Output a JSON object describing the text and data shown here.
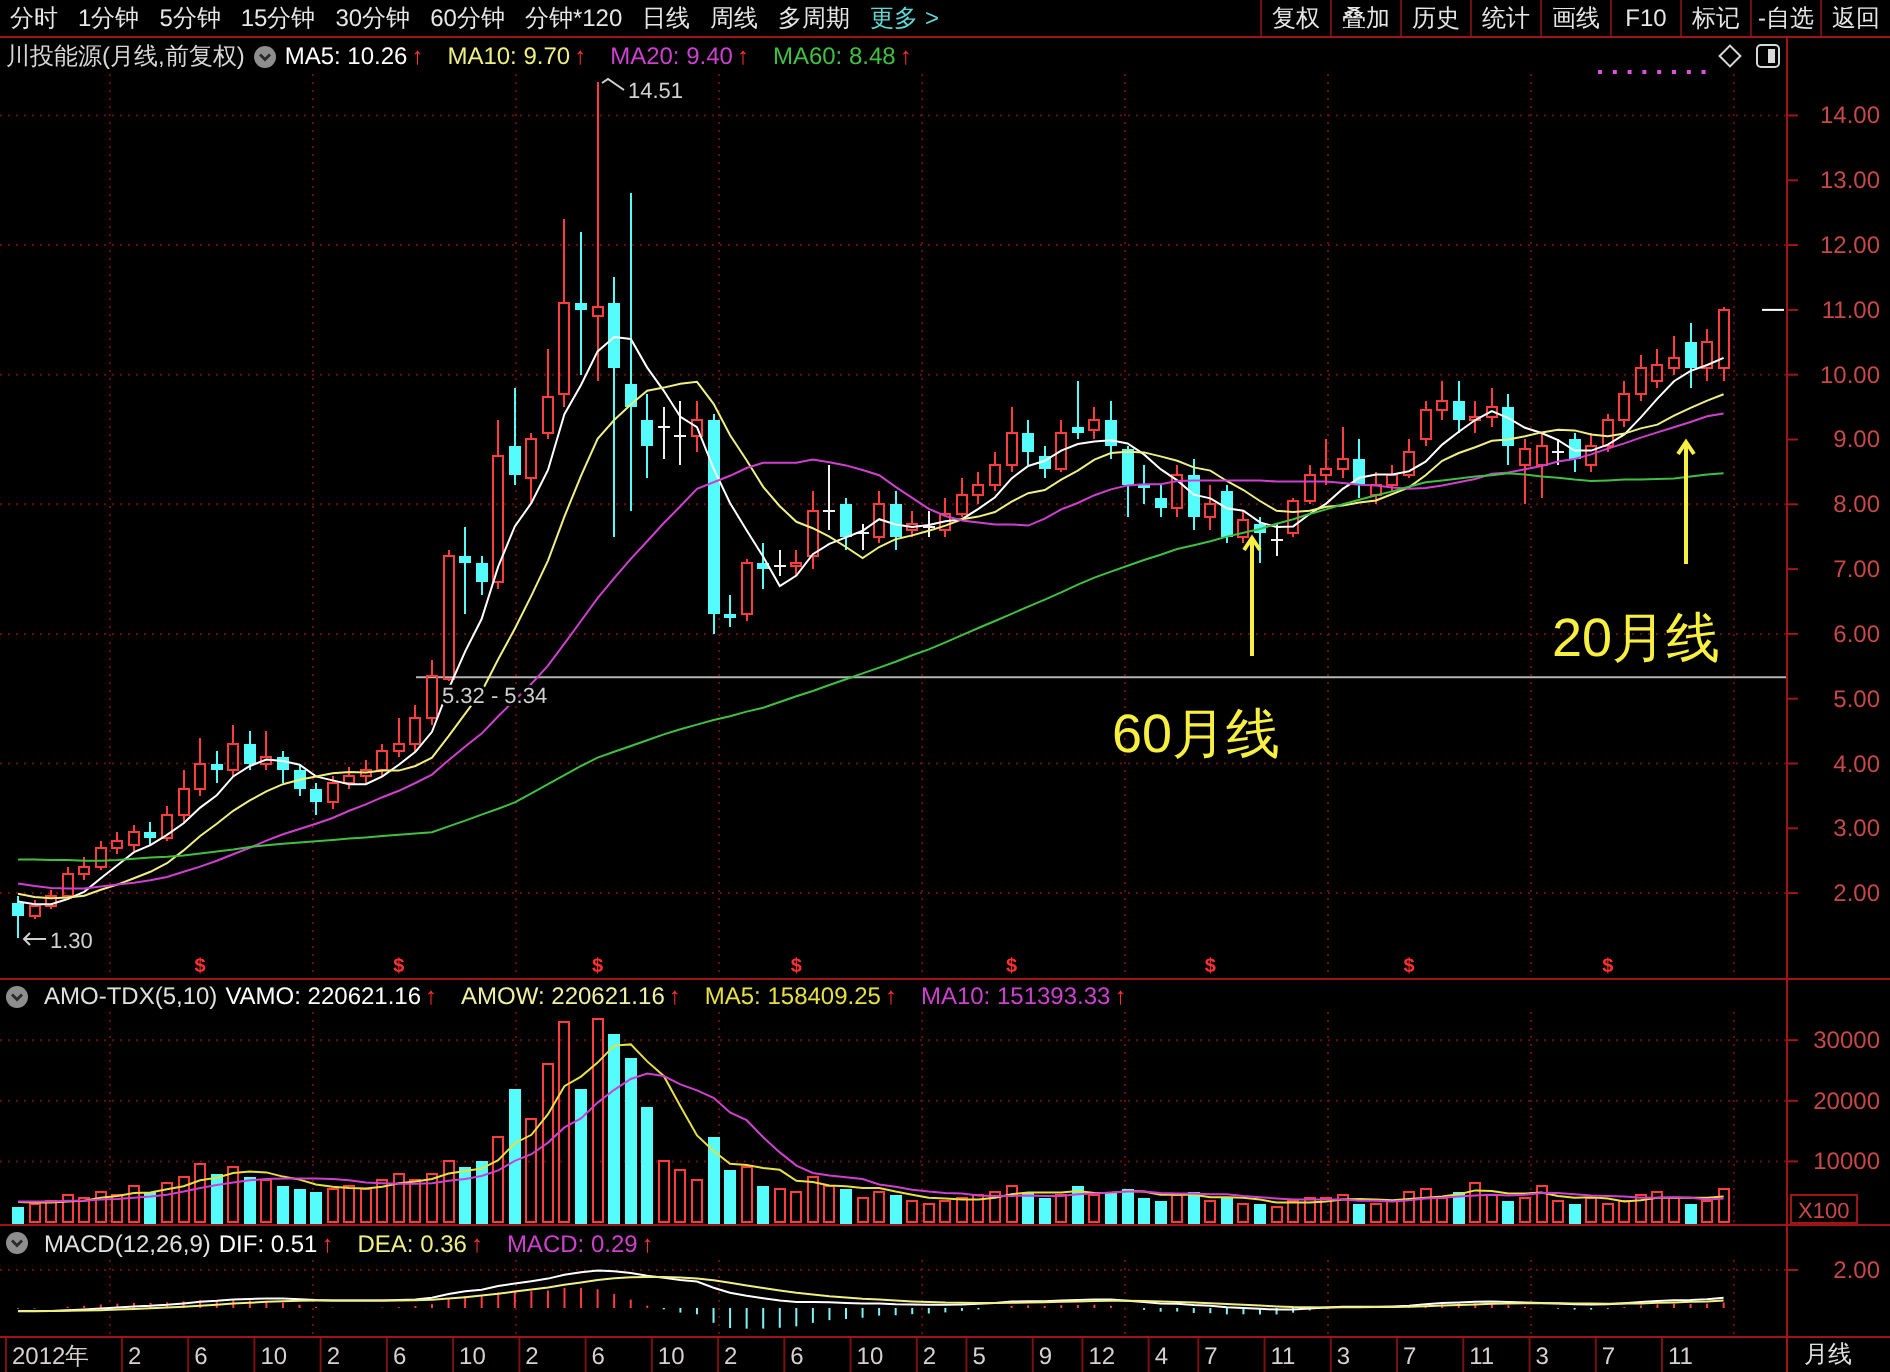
{
  "menu": {
    "periods": [
      {
        "label": "分时",
        "selected": false
      },
      {
        "label": "1分钟",
        "selected": false
      },
      {
        "label": "5分钟",
        "selected": false
      },
      {
        "label": "15分钟",
        "selected": false
      },
      {
        "label": "30分钟",
        "selected": false
      },
      {
        "label": "60分钟",
        "selected": false
      },
      {
        "label": "分钟*120",
        "selected": false
      },
      {
        "label": "日线",
        "selected": false
      },
      {
        "label": "周线",
        "selected": false
      },
      {
        "label": "多周期",
        "selected": false
      },
      {
        "label": "更多 >",
        "selected": true
      }
    ],
    "tools": [
      "复权",
      "叠加",
      "历史",
      "统计",
      "画线",
      "F10",
      "标记",
      "-自选",
      "返回"
    ]
  },
  "price_panel": {
    "title": "川投能源(月线,前复权)",
    "indicators": [
      {
        "text": "MA5: 10.26",
        "trend": "↑",
        "color": "#ffffff"
      },
      {
        "text": "MA10: 9.70",
        "trend": "↑",
        "color": "#f0f080"
      },
      {
        "text": "MA20: 9.40",
        "trend": "↑",
        "color": "#d040d0"
      },
      {
        "text": "MA60: 8.48",
        "trend": "↑",
        "color": "#40c040"
      }
    ],
    "chart_data": {
      "type": "candlestick",
      "grid": true,
      "ylim": [
        0.69,
        14.64
      ],
      "yticks": [
        {
          "value": 14,
          "label": "14.00"
        },
        {
          "value": 13,
          "label": "13.00"
        },
        {
          "value": 12,
          "label": "12.00"
        },
        {
          "value": 11,
          "label": "11.00"
        },
        {
          "value": 10,
          "label": "10.00"
        },
        {
          "value": 9,
          "label": "9.00"
        },
        {
          "value": 8,
          "label": "8.00"
        },
        {
          "value": 7,
          "label": "7.00"
        },
        {
          "value": 6,
          "label": "6.00"
        },
        {
          "value": 5,
          "label": "5.00"
        },
        {
          "value": 4,
          "label": "4.00"
        },
        {
          "value": 3,
          "label": "3.00"
        },
        {
          "value": 2,
          "label": "2.00"
        }
      ],
      "ohlc": [
        [
          1.85,
          1.95,
          1.3,
          1.65
        ],
        [
          1.65,
          1.9,
          1.6,
          1.8
        ],
        [
          1.8,
          2.05,
          1.75,
          1.95
        ],
        [
          1.95,
          2.4,
          1.9,
          2.3
        ],
        [
          2.3,
          2.55,
          2.2,
          2.4
        ],
        [
          2.4,
          2.8,
          2.35,
          2.7
        ],
        [
          2.7,
          2.95,
          2.6,
          2.8
        ],
        [
          2.75,
          3.05,
          2.65,
          2.95
        ],
        [
          2.95,
          3.1,
          2.75,
          2.85
        ],
        [
          2.85,
          3.35,
          2.8,
          3.2
        ],
        [
          3.2,
          3.9,
          3.1,
          3.6
        ],
        [
          3.6,
          4.4,
          3.5,
          4.0
        ],
        [
          4.0,
          4.2,
          3.7,
          3.9
        ],
        [
          3.9,
          4.6,
          3.8,
          4.3
        ],
        [
          4.3,
          4.5,
          3.9,
          4.0
        ],
        [
          4.0,
          4.5,
          3.9,
          4.1
        ],
        [
          4.1,
          4.2,
          3.7,
          3.9
        ],
        [
          3.9,
          4.0,
          3.5,
          3.6
        ],
        [
          3.6,
          3.7,
          3.2,
          3.4
        ],
        [
          3.4,
          3.8,
          3.3,
          3.7
        ],
        [
          3.7,
          3.95,
          3.6,
          3.8
        ],
        [
          3.8,
          4.05,
          3.7,
          3.9
        ],
        [
          3.9,
          4.3,
          3.8,
          4.2
        ],
        [
          4.2,
          4.7,
          4.1,
          4.3
        ],
        [
          4.3,
          4.9,
          4.2,
          4.7
        ],
        [
          4.7,
          5.6,
          4.6,
          5.35
        ],
        [
          5.3,
          7.3,
          5.28,
          7.2
        ],
        [
          7.2,
          7.65,
          6.3,
          7.1
        ],
        [
          7.1,
          7.2,
          6.6,
          6.8
        ],
        [
          6.8,
          9.3,
          6.7,
          8.75
        ],
        [
          8.9,
          9.8,
          8.3,
          8.45
        ],
        [
          8.4,
          9.1,
          8.0,
          9.0
        ],
        [
          9.1,
          10.4,
          9.0,
          9.65
        ],
        [
          9.7,
          12.4,
          9.5,
          11.1
        ],
        [
          11.1,
          12.2,
          10.0,
          11.0
        ],
        [
          10.9,
          14.51,
          9.9,
          11.05
        ],
        [
          11.1,
          11.5,
          7.5,
          10.1
        ],
        [
          9.85,
          12.8,
          7.9,
          9.5
        ],
        [
          9.3,
          9.7,
          8.4,
          8.9
        ],
        [
          9.2,
          9.5,
          8.7,
          9.2
        ],
        [
          9.05,
          9.6,
          8.6,
          9.05
        ],
        [
          9.05,
          9.6,
          8.8,
          9.3
        ],
        [
          9.3,
          9.4,
          6.0,
          6.3
        ],
        [
          6.3,
          6.6,
          6.1,
          6.25
        ],
        [
          6.3,
          7.15,
          6.2,
          7.1
        ],
        [
          7.1,
          7.4,
          6.7,
          7.0
        ],
        [
          7.05,
          7.3,
          6.9,
          7.05
        ],
        [
          7.05,
          7.3,
          6.9,
          7.1
        ],
        [
          7.2,
          8.2,
          7.0,
          7.9
        ],
        [
          7.9,
          8.6,
          7.6,
          7.9
        ],
        [
          8.0,
          8.1,
          7.3,
          7.5
        ],
        [
          7.55,
          7.7,
          7.3,
          7.55
        ],
        [
          7.5,
          8.2,
          7.4,
          8.0
        ],
        [
          8.0,
          8.2,
          7.3,
          7.5
        ],
        [
          7.6,
          7.9,
          7.5,
          7.7
        ],
        [
          7.65,
          7.9,
          7.5,
          7.65
        ],
        [
          7.6,
          8.1,
          7.5,
          7.85
        ],
        [
          7.85,
          8.4,
          7.8,
          8.15
        ],
        [
          8.15,
          8.5,
          8.0,
          8.3
        ],
        [
          8.3,
          8.8,
          8.2,
          8.6
        ],
        [
          8.6,
          9.5,
          8.5,
          9.1
        ],
        [
          9.1,
          9.3,
          8.6,
          8.8
        ],
        [
          8.75,
          8.9,
          8.4,
          8.55
        ],
        [
          8.55,
          9.3,
          8.5,
          9.1
        ],
        [
          9.2,
          9.9,
          9.0,
          9.1
        ],
        [
          9.15,
          9.5,
          9.0,
          9.3
        ],
        [
          9.3,
          9.6,
          8.7,
          8.9
        ],
        [
          8.85,
          8.9,
          7.8,
          8.3
        ],
        [
          8.3,
          8.6,
          8.0,
          8.25
        ],
        [
          8.1,
          8.3,
          7.8,
          7.95
        ],
        [
          7.95,
          8.6,
          7.8,
          8.45
        ],
        [
          8.45,
          8.7,
          7.6,
          7.8
        ],
        [
          7.8,
          8.3,
          7.6,
          8.0
        ],
        [
          8.2,
          8.3,
          7.4,
          7.5
        ],
        [
          7.5,
          7.9,
          7.4,
          7.75
        ],
        [
          7.7,
          7.8,
          7.1,
          7.55
        ],
        [
          7.45,
          7.7,
          7.2,
          7.45
        ],
        [
          7.55,
          8.1,
          7.5,
          8.05
        ],
        [
          8.05,
          8.6,
          8.0,
          8.45
        ],
        [
          8.45,
          9.0,
          8.3,
          8.55
        ],
        [
          8.55,
          9.2,
          8.4,
          8.7
        ],
        [
          8.7,
          9.0,
          8.1,
          8.3
        ],
        [
          8.15,
          8.5,
          8.0,
          8.3
        ],
        [
          8.3,
          8.6,
          8.2,
          8.45
        ],
        [
          8.45,
          9.0,
          8.4,
          8.8
        ],
        [
          9.0,
          9.6,
          8.9,
          9.45
        ],
        [
          9.45,
          9.9,
          9.3,
          9.6
        ],
        [
          9.6,
          9.9,
          9.1,
          9.3
        ],
        [
          9.3,
          9.6,
          9.1,
          9.35
        ],
        [
          9.35,
          9.8,
          9.2,
          9.5
        ],
        [
          9.5,
          9.7,
          8.6,
          8.9
        ],
        [
          8.6,
          9.0,
          8.0,
          8.85
        ],
        [
          8.6,
          9.1,
          8.1,
          8.9
        ],
        [
          8.8,
          9.0,
          8.6,
          8.8
        ],
        [
          9.0,
          9.1,
          8.5,
          8.7
        ],
        [
          8.6,
          9.1,
          8.5,
          8.9
        ],
        [
          8.9,
          9.4,
          8.8,
          9.3
        ],
        [
          9.3,
          9.9,
          9.2,
          9.7
        ],
        [
          9.7,
          10.3,
          9.6,
          10.1
        ],
        [
          9.9,
          10.4,
          9.8,
          10.15
        ],
        [
          10.1,
          10.6,
          10.0,
          10.25
        ],
        [
          10.5,
          10.8,
          9.8,
          10.1
        ],
        [
          10.1,
          10.7,
          9.9,
          10.5
        ],
        [
          10.1,
          11.05,
          9.9,
          11.0
        ]
      ],
      "series": [
        {
          "type": "line",
          "color": "#ffffff",
          "values": [
            1.87,
            1.83,
            1.83,
            1.91,
            2.02,
            2.23,
            2.43,
            2.63,
            2.74,
            2.9,
            3.08,
            3.32,
            3.51,
            3.8,
            3.96,
            4.06,
            4.04,
            3.98,
            3.8,
            3.74,
            3.68,
            3.68,
            3.8,
            3.98,
            4.18,
            4.49,
            5.15,
            5.73,
            6.23,
            7.04,
            7.66,
            8.02,
            8.53,
            9.39,
            9.84,
            10.36,
            10.58,
            10.55,
            10.11,
            9.75,
            9.35,
            9.19,
            8.55,
            8.02,
            7.6,
            7.19,
            6.74,
            6.9,
            7.23,
            7.39,
            7.49,
            7.59,
            7.77,
            7.69,
            7.65,
            7.68,
            7.74,
            7.77,
            7.93,
            8.11,
            8.4,
            8.59,
            8.67,
            8.83,
            8.93,
            8.97,
            8.99,
            8.94,
            8.77,
            8.54,
            8.37,
            8.15,
            8.09,
            7.94,
            7.9,
            7.72,
            7.65,
            7.66,
            7.85,
            8.01,
            8.24,
            8.41,
            8.46,
            8.46,
            8.51,
            8.66,
            8.92,
            9.12,
            9.3,
            9.44,
            9.33,
            9.18,
            9.1,
            8.99,
            8.83,
            8.83,
            8.92,
            9.08,
            9.34,
            9.63,
            9.9,
            10.06,
            10.15,
            10.26
          ]
        },
        {
          "type": "line",
          "color": "#f0f080",
          "values": [
            1.99,
            1.94,
            1.92,
            1.93,
            1.96,
            2.05,
            2.13,
            2.23,
            2.33,
            2.46,
            2.66,
            2.88,
            3.07,
            3.27,
            3.43,
            3.57,
            3.68,
            3.75,
            3.8,
            3.85,
            3.87,
            3.86,
            3.89,
            3.89,
            3.96,
            4.09,
            4.42,
            4.77,
            5.11,
            5.61,
            6.08,
            6.59,
            7.13,
            7.81,
            8.44,
            9.01,
            9.3,
            9.54,
            9.75,
            9.8,
            9.86,
            9.89,
            9.55,
            9.07,
            8.68,
            8.27,
            7.97,
            7.73,
            7.63,
            7.5,
            7.34,
            7.17,
            7.34,
            7.46,
            7.52,
            7.59,
            7.67,
            7.77,
            7.81,
            7.88,
            8.04,
            8.17,
            8.22,
            8.38,
            8.52,
            8.69,
            8.79,
            8.81,
            8.8,
            8.74,
            8.67,
            8.57,
            8.52,
            8.36,
            8.22,
            8.05,
            7.9,
            7.88,
            7.9,
            7.96,
            7.98,
            8.03,
            8.06,
            8.16,
            8.26,
            8.45,
            8.67,
            8.79,
            8.88,
            8.98,
            9.0,
            9.05,
            9.11,
            9.15,
            9.14,
            9.08,
            9.05,
            9.09,
            9.17,
            9.23,
            9.37,
            9.49,
            9.6,
            9.7
          ]
        },
        {
          "type": "line",
          "color": "#d040d0",
          "values": [
            2.15,
            2.11,
            2.08,
            2.07,
            2.07,
            2.1,
            2.13,
            2.16,
            2.2,
            2.25,
            2.33,
            2.41,
            2.5,
            2.6,
            2.7,
            2.81,
            2.91,
            2.99,
            3.07,
            3.16,
            3.27,
            3.37,
            3.48,
            3.58,
            3.7,
            3.83,
            4.05,
            4.26,
            4.46,
            4.73,
            4.98,
            5.23,
            5.51,
            5.85,
            6.2,
            6.55,
            6.86,
            7.16,
            7.43,
            7.71,
            7.97,
            8.24,
            8.34,
            8.44,
            8.56,
            8.64,
            8.64,
            8.64,
            8.69,
            8.65,
            8.6,
            8.53,
            8.45,
            8.27,
            8.1,
            7.93,
            7.82,
            7.75,
            7.72,
            7.69,
            7.69,
            7.67,
            7.78,
            7.92,
            8.02,
            8.14,
            8.23,
            8.29,
            8.31,
            8.31,
            8.36,
            8.37,
            8.37,
            8.37,
            8.37,
            8.37,
            8.35,
            8.35,
            8.35,
            8.35,
            8.33,
            8.3,
            8.29,
            8.26,
            8.24,
            8.25,
            8.29,
            8.34,
            8.39,
            8.47,
            8.49,
            8.54,
            8.59,
            8.66,
            8.7,
            8.77,
            8.86,
            8.94,
            9.03,
            9.11,
            9.19,
            9.27,
            9.36,
            9.4
          ]
        },
        {
          "type": "line",
          "color": "#40c040",
          "values": [
            2.52,
            2.52,
            2.51,
            2.51,
            2.5,
            2.5,
            2.51,
            2.53,
            2.55,
            2.56,
            2.58,
            2.61,
            2.64,
            2.67,
            2.71,
            2.74,
            2.76,
            2.78,
            2.8,
            2.82,
            2.84,
            2.86,
            2.88,
            2.9,
            2.92,
            2.94,
            3.03,
            3.12,
            3.21,
            3.3,
            3.4,
            3.54,
            3.68,
            3.82,
            3.96,
            4.09,
            4.18,
            4.27,
            4.36,
            4.45,
            4.53,
            4.6,
            4.67,
            4.73,
            4.8,
            4.86,
            4.95,
            5.04,
            5.12,
            5.21,
            5.3,
            5.39,
            5.48,
            5.57,
            5.67,
            5.76,
            5.87,
            5.98,
            6.09,
            6.2,
            6.31,
            6.42,
            6.53,
            6.64,
            6.76,
            6.87,
            6.96,
            7.05,
            7.14,
            7.22,
            7.31,
            7.37,
            7.43,
            7.5,
            7.56,
            7.62,
            7.7,
            7.77,
            7.85,
            7.92,
            8.0,
            8.07,
            8.14,
            8.2,
            8.27,
            8.34,
            8.37,
            8.4,
            8.43,
            8.45,
            8.48,
            8.46,
            8.43,
            8.41,
            8.38,
            8.36,
            8.37,
            8.38,
            8.38,
            8.39,
            8.4,
            8.43,
            8.46,
            8.48
          ]
        }
      ]
    },
    "high_label": "14.51",
    "low_label": "1.30",
    "line_label": "5.32 - 5.34",
    "annotations": [
      "60月线",
      "20月线"
    ],
    "dividend_marks": [
      "$",
      "$",
      "$",
      "$",
      "$",
      "$",
      "$",
      "$"
    ]
  },
  "volume_panel": {
    "name": "AMO-TDX(5,10)",
    "indicators": [
      {
        "text": "VAMO: 220621.16",
        "trend": "↑",
        "color": "#ffffff"
      },
      {
        "text": "AMOW: 220621.16",
        "trend": "↑",
        "color": "#f0f0a0"
      },
      {
        "text": "MA5: 158409.25",
        "trend": "↑",
        "color": "#e8e040"
      },
      {
        "text": "MA10: 151393.33",
        "trend": "↑",
        "color": "#d040d0"
      }
    ],
    "chart_data": {
      "type": "bar",
      "grid": true,
      "ylim": [
        0,
        34650
      ],
      "yticks": [
        30000,
        20000,
        10000
      ],
      "series": [
        {
          "type": "bar",
          "values": [
            2500,
            3000,
            3500,
            4500,
            4000,
            5000,
            4500,
            6000,
            5000,
            6500,
            7500,
            9500,
            8000,
            9000,
            7500,
            7000,
            6000,
            5500,
            5000,
            5500,
            6000,
            5500,
            7000,
            8000,
            7000,
            8000,
            10000,
            9000,
            10000,
            14000,
            22000,
            17000,
            26000,
            33000,
            22000,
            33500,
            31000,
            27000,
            19000,
            10000,
            8500,
            7000,
            14000,
            8500,
            9000,
            6000,
            5500,
            5000,
            7500,
            6000,
            5500,
            4000,
            5000,
            4500,
            3500,
            3000,
            3500,
            4000,
            4500,
            5000,
            6000,
            5000,
            4000,
            4500,
            6000,
            4500,
            5000,
            5500,
            4000,
            3500,
            4500,
            5000,
            3500,
            4000,
            3000,
            3000,
            2500,
            3500,
            4000,
            4000,
            4500,
            3000,
            3000,
            3500,
            5000,
            5500,
            4000,
            5000,
            6500,
            4500,
            3500,
            4000,
            6000,
            3500,
            3000,
            4000,
            3000,
            3500,
            4500,
            5000,
            4000,
            3000,
            3500,
            5500
          ],
          "colors": [
            "#54fcfc",
            "#ff3c3c",
            "#ff3c3c",
            "#ff3c3c",
            "#ff3c3c",
            "#ff3c3c",
            "#ff3c3c",
            "#ff3c3c",
            "#54fcfc",
            "#ff3c3c",
            "#ff3c3c",
            "#ff3c3c",
            "#54fcfc",
            "#ff3c3c",
            "#54fcfc",
            "#ff3c3c",
            "#54fcfc",
            "#54fcfc",
            "#54fcfc",
            "#ff3c3c",
            "#ff3c3c",
            "#ff3c3c",
            "#ff3c3c",
            "#ff3c3c",
            "#ff3c3c",
            "#ff3c3c",
            "#ff3c3c",
            "#54fcfc",
            "#54fcfc",
            "#ff3c3c",
            "#54fcfc",
            "#ff3c3c",
            "#ff3c3c",
            "#ff3c3c",
            "#54fcfc",
            "#ff3c3c",
            "#54fcfc",
            "#54fcfc",
            "#54fcfc",
            "#ff3c3c",
            "#ff3c3c",
            "#ff3c3c",
            "#54fcfc",
            "#54fcfc",
            "#ff3c3c",
            "#54fcfc",
            "#ff3c3c",
            "#ff3c3c",
            "#ff3c3c",
            "#ff3c3c",
            "#54fcfc",
            "#ff3c3c",
            "#ff3c3c",
            "#54fcfc",
            "#ff3c3c",
            "#ff3c3c",
            "#ff3c3c",
            "#ff3c3c",
            "#ff3c3c",
            "#ff3c3c",
            "#ff3c3c",
            "#54fcfc",
            "#54fcfc",
            "#ff3c3c",
            "#54fcfc",
            "#ff3c3c",
            "#54fcfc",
            "#54fcfc",
            "#54fcfc",
            "#54fcfc",
            "#ff3c3c",
            "#54fcfc",
            "#ff3c3c",
            "#54fcfc",
            "#ff3c3c",
            "#54fcfc",
            "#ff3c3c",
            "#ff3c3c",
            "#ff3c3c",
            "#ff3c3c",
            "#ff3c3c",
            "#54fcfc",
            "#ff3c3c",
            "#ff3c3c",
            "#ff3c3c",
            "#ff3c3c",
            "#ff3c3c",
            "#54fcfc",
            "#ff3c3c",
            "#ff3c3c",
            "#54fcfc",
            "#ff3c3c",
            "#ff3c3c",
            "#ff3c3c",
            "#54fcfc",
            "#ff3c3c",
            "#ff3c3c",
            "#ff3c3c",
            "#ff3c3c",
            "#ff3c3c",
            "#ff3c3c",
            "#54fcfc",
            "#ff3c3c",
            "#ff3c3c"
          ]
        },
        {
          "type": "line",
          "color": "#e8e040",
          "values": [
            3300,
            3200,
            3200,
            3400,
            3500,
            4000,
            4300,
            4800,
            4900,
            5400,
            5900,
            6900,
            7300,
            8100,
            8300,
            8200,
            7500,
            7000,
            6200,
            5800,
            5600,
            5500,
            5800,
            6400,
            6700,
            7100,
            8000,
            8400,
            8800,
            10200,
            13000,
            14400,
            17800,
            22400,
            24000,
            26300,
            29100,
            29300,
            26500,
            24100,
            19100,
            14300,
            11700,
            9600,
            9400,
            8900,
            8600,
            6800,
            6600,
            6000,
            5900,
            5600,
            5600,
            5000,
            4500,
            4000,
            3900,
            3700,
            3700,
            4000,
            4600,
            4900,
            4900,
            4900,
            5100,
            4800,
            4800,
            5100,
            5000,
            4500,
            4500,
            4500,
            4100,
            4100,
            4000,
            3700,
            3200,
            3200,
            3200,
            3400,
            3700,
            3800,
            3700,
            3600,
            3800,
            4000,
            4200,
            4600,
            5200,
            5100,
            4700,
            4700,
            4900,
            4300,
            4000,
            4100,
            3900,
            3400,
            3600,
            4000,
            4000,
            4000,
            4000,
            4200
          ]
        },
        {
          "type": "line",
          "color": "#d040d0",
          "values": [
            3400,
            3400,
            3400,
            3500,
            3500,
            3700,
            3800,
            4000,
            4200,
            4500,
            5000,
            5600,
            6100,
            6500,
            6900,
            7100,
            7200,
            7200,
            7200,
            7100,
            6900,
            6500,
            6400,
            6300,
            6300,
            6400,
            6800,
            7100,
            7600,
            8500,
            10100,
            11200,
            13100,
            15600,
            17100,
            19700,
            21800,
            23600,
            24500,
            24100,
            22700,
            21700,
            20500,
            18100,
            16800,
            14000,
            11500,
            9300,
            8100,
            7700,
            7400,
            7100,
            6200,
            5800,
            5300,
            5000,
            4800,
            4700,
            4400,
            4300,
            4300,
            4400,
            4300,
            4300,
            4600,
            4700,
            4900,
            5000,
            5000,
            4800,
            4700,
            4700,
            4600,
            4600,
            4300,
            4100,
            3900,
            3700,
            3700,
            3700,
            3700,
            3500,
            3500,
            3400,
            3600,
            3900,
            4000,
            4200,
            4400,
            4500,
            4400,
            4500,
            4800,
            4800,
            4600,
            4400,
            4300,
            4200,
            4000,
            4000,
            4100,
            4000,
            3700,
            3900
          ]
        }
      ]
    },
    "unit": "X100"
  },
  "macd_panel": {
    "name": "MACD(12,26,9)",
    "indicators": [
      {
        "text": "DIF: 0.51",
        "trend": "↑",
        "color": "#ffffff"
      },
      {
        "text": "DEA: 0.36",
        "trend": "↑",
        "color": "#f0f080"
      },
      {
        "text": "MACD: 0.29",
        "trend": "↑",
        "color": "#d040d0"
      }
    ],
    "axis_labels": [
      "2.00"
    ]
  },
  "x_axis": {
    "labels": [
      "2012年",
      "2",
      "6",
      "10",
      "2",
      "6",
      "10",
      "2",
      "6",
      "10",
      "2",
      "6",
      "10",
      "2",
      "5",
      "9",
      "12",
      "4",
      "7",
      "11",
      "3",
      "7",
      "11",
      "3",
      "7",
      "11"
    ],
    "period": "月线"
  }
}
